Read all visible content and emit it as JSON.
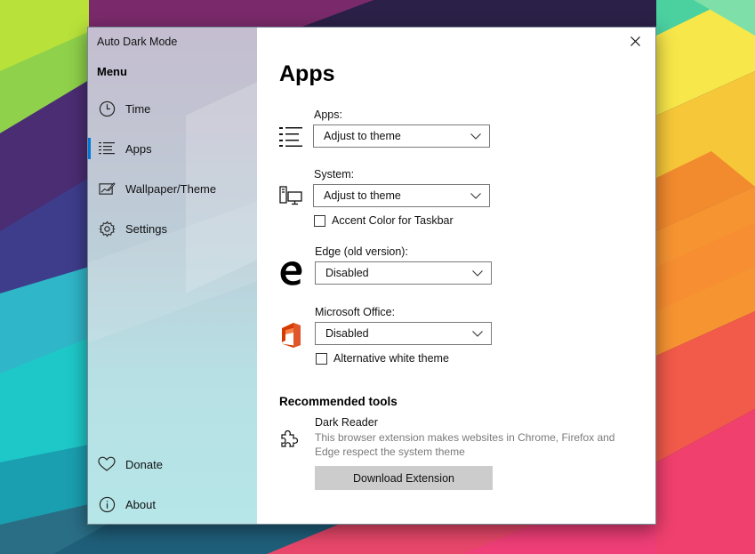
{
  "window": {
    "title": "Auto Dark Mode"
  },
  "sidebar": {
    "menu_header": "Menu",
    "items": [
      {
        "label": "Time",
        "icon": "clock-icon",
        "active": false
      },
      {
        "label": "Apps",
        "icon": "list-icon",
        "active": true
      },
      {
        "label": "Wallpaper/Theme",
        "icon": "wallpaper-icon",
        "active": false
      },
      {
        "label": "Settings",
        "icon": "gear-icon",
        "active": false
      }
    ],
    "bottom_items": [
      {
        "label": "Donate",
        "icon": "heart-icon"
      },
      {
        "label": "About",
        "icon": "info-icon"
      }
    ]
  },
  "page": {
    "title": "Apps",
    "apps": {
      "label": "Apps:",
      "value": "Adjust to theme",
      "icon": "list-icon"
    },
    "system": {
      "label": "System:",
      "value": "Adjust to theme",
      "icon": "desktop-icon",
      "checkbox_label": "Accent Color for Taskbar",
      "checked": false
    },
    "edge": {
      "label": "Edge (old version):",
      "value": "Disabled",
      "icon": "edge-icon"
    },
    "office": {
      "label": "Microsoft Office:",
      "value": "Disabled",
      "icon": "office-icon",
      "checkbox_label": "Alternative white theme",
      "checked": false
    },
    "recommended": {
      "title": "Recommended tools",
      "tool_name": "Dark Reader",
      "tool_description": "This browser extension makes websites in Chrome, Firefox and Edge respect the system theme",
      "button_label": "Download Extension",
      "icon": "puzzle-icon"
    }
  },
  "colors": {
    "accent": "#0078d7",
    "office_red": "#d83b01",
    "button_gray": "#cccccc"
  }
}
